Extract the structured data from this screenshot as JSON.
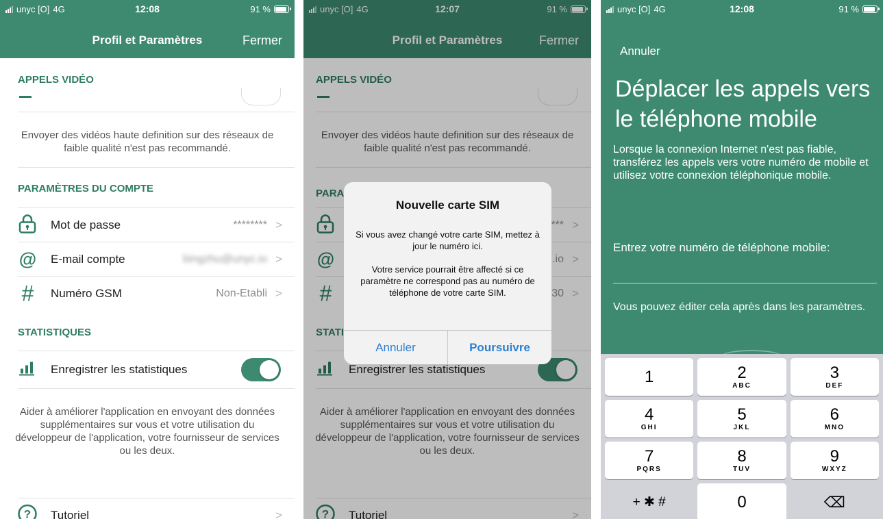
{
  "status_bar": {
    "carrier": "unyc [O]",
    "network": "4G",
    "battery": "91 %"
  },
  "screen1": {
    "time": "12:08",
    "nav": {
      "title": "Profil et Paramètres",
      "close": "Fermer"
    },
    "video_section": {
      "header": "APPELS VIDÉO",
      "description": "Envoyer des vidéos haute definition sur des réseaux de faible qualité n'est pas recommandé."
    },
    "account_section": {
      "header": "PARAMÈTRES DU COMPTE",
      "rows": [
        {
          "icon": "lock-icon",
          "label": "Mot de passe",
          "value": "********"
        },
        {
          "icon": "at-icon",
          "label": "E-mail compte",
          "value": "bingzhu@unyc.io"
        },
        {
          "icon": "hash-icon",
          "label": "Numéro GSM",
          "value": "Non-Etabli"
        }
      ]
    },
    "stats_section": {
      "header": "STATISTIQUES",
      "row_label": "Enregistrer les statistiques",
      "toggle_on": true,
      "description": "Aider à améliorer l'application en envoyant des données supplémentaires sur vous et votre utilisation du développeur de l'application, votre fournisseur de services ou les deux."
    },
    "tutorial": {
      "icon": "question-icon",
      "label": "Tutoriel"
    }
  },
  "screen2": {
    "time": "12:07",
    "account_rows_partial": [
      {
        "icon": "lock-icon",
        "value": "***"
      },
      {
        "icon": "at-icon",
        "value": ".io"
      },
      {
        "icon": "hash-icon",
        "value": "30"
      }
    ],
    "section_partial": {
      "account": "PARA",
      "stats": "STATI"
    },
    "alert": {
      "title": "Nouvelle carte SIM",
      "message_1": "Si vous avez changé votre carte SIM, mettez à jour le numéro ici.",
      "message_2": "Votre service pourrait être affecté si ce paramètre ne correspond pas au numéro de téléphone de votre carte SIM.",
      "cancel": "Annuler",
      "confirm": "Poursuivre"
    }
  },
  "screen3": {
    "time": "12:08",
    "cancel": "Annuler",
    "heading": "Déplacer les appels vers le téléphone mobile",
    "intro": "Lorsque la connexion Internet n'est pas fiable, transférez les appels vers votre numéro de mobile et utilisez votre connexion téléphonique mobile.",
    "phone_label": "Entrez votre numéro de téléphone mobile:",
    "phone_value": "",
    "note": "Vous pouvez éditer cela après dans les paramètres.",
    "keypad": [
      {
        "num": "1",
        "sub": ""
      },
      {
        "num": "2",
        "sub": "ABC"
      },
      {
        "num": "3",
        "sub": "DEF"
      },
      {
        "num": "4",
        "sub": "GHI"
      },
      {
        "num": "5",
        "sub": "JKL"
      },
      {
        "num": "6",
        "sub": "MNO"
      },
      {
        "num": "7",
        "sub": "PQRS"
      },
      {
        "num": "8",
        "sub": "TUV"
      },
      {
        "num": "9",
        "sub": "WXYZ"
      },
      {
        "num": "+ ✱ #",
        "sub": ""
      },
      {
        "num": "0",
        "sub": ""
      },
      {
        "num": "⌫",
        "sub": ""
      }
    ]
  },
  "colors": {
    "brand": "#3d8a70",
    "accent_text": "#2e7d63",
    "link_blue": "#2f7fce"
  }
}
